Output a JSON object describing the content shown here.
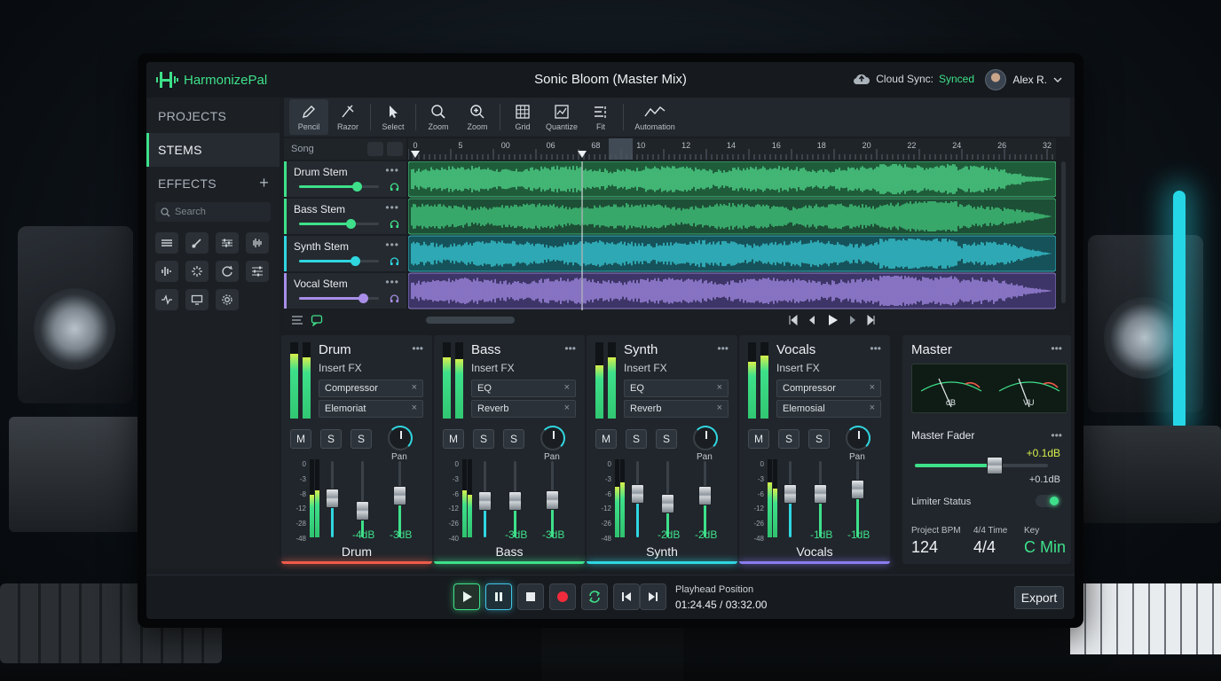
{
  "app": {
    "name": "HarmonizePal",
    "project_title": "Sonic Bloom (Master Mix)",
    "cloud_sync_label": "Cloud Sync:",
    "cloud_sync_status": "Synced",
    "user_name": "Alex R."
  },
  "sidebar": {
    "items": [
      {
        "label": "PROJECTS"
      },
      {
        "label": "STEMS"
      },
      {
        "label": "EFFECTS"
      }
    ],
    "search_placeholder": "Search",
    "add_label": "+",
    "fx_icons": [
      "stack-icon",
      "guitar-icon",
      "eq-sliders-icon",
      "waveform-icon",
      "bars-icon",
      "sparkle-icon",
      "loop-icon",
      "mixer-icon",
      "pulse-icon",
      "monitor-icon",
      "gear-icon"
    ]
  },
  "toolbar": {
    "tools": [
      {
        "label": "Pencil",
        "icon": "pencil-icon"
      },
      {
        "label": "Razor",
        "icon": "razor-icon"
      },
      {
        "label": "Select",
        "icon": "cursor-icon"
      },
      {
        "label": "Zoom",
        "icon": "zoom-out-icon"
      },
      {
        "label": "Zoom",
        "icon": "zoom-in-icon"
      },
      {
        "label": "Grid",
        "icon": "grid-icon"
      },
      {
        "label": "Quantize",
        "icon": "quantize-icon"
      },
      {
        "label": "Fit",
        "icon": "fit-icon"
      },
      {
        "label": "Automation",
        "icon": "automation-icon"
      }
    ]
  },
  "timeline": {
    "song_label": "Song",
    "ruler_ticks": [
      "0",
      "5",
      "00",
      "06",
      "68",
      "10",
      "12",
      "14",
      "16",
      "18",
      "20",
      "22",
      "24",
      "26",
      "32"
    ]
  },
  "tracks": [
    {
      "name": "Drum Stem",
      "color": "#3ee08a",
      "volume": 0.72
    },
    {
      "name": "Bass Stem",
      "color": "#3ee08a",
      "volume": 0.65
    },
    {
      "name": "Synth Stem",
      "color": "#2fd6e0",
      "volume": 0.7
    },
    {
      "name": "Vocal Stem",
      "color": "#a88ee8",
      "volume": 0.8
    }
  ],
  "mixer": {
    "insert_label": "Insert FX",
    "pan_label": "Pan",
    "scale": [
      "0",
      "-3",
      "-8",
      "-12",
      "-28",
      "-48"
    ],
    "strips": [
      {
        "name": "Drum",
        "fx": [
          "Compressor",
          "Elemoriat"
        ],
        "db_a": "-4dB",
        "db_b": "-3dB",
        "color": "#ef5a4a",
        "footer": "Drum",
        "vu": [
          0.85,
          0.8
        ],
        "mvu": [
          0.55,
          0.6
        ],
        "fader_a": 0.62,
        "fader_b": 0.38,
        "fader_c": 0.66,
        "scale": [
          "0",
          "-3",
          "-8",
          "-12",
          "-28",
          "-48"
        ]
      },
      {
        "name": "Bass",
        "fx": [
          "EQ",
          "Reverb"
        ],
        "db_a": "-3dB",
        "db_b": "-3dB",
        "color": "#3ee08a",
        "footer": "Bass",
        "vu": [
          0.8,
          0.78
        ],
        "mvu": [
          0.6,
          0.55
        ],
        "fader_a": 0.56,
        "fader_b": 0.56,
        "fader_c": 0.58,
        "scale": [
          "0",
          "-3",
          "-6",
          "-12",
          "-26",
          "-40"
        ]
      },
      {
        "name": "Synth",
        "fx": [
          "EQ",
          "Reverb"
        ],
        "db_a": "-2dB",
        "db_b": "-2dB",
        "color": "#2fd6e0",
        "footer": "Synth",
        "vu": [
          0.7,
          0.8
        ],
        "mvu": [
          0.65,
          0.7
        ],
        "fader_a": 0.7,
        "fader_b": 0.52,
        "fader_c": 0.66,
        "scale": [
          "0",
          "-3",
          "-6",
          "-12",
          "-26",
          "-48"
        ]
      },
      {
        "name": "Vocals",
        "fx": [
          "Compressor",
          "Elemosial"
        ],
        "db_a": "-1dB",
        "db_b": "-1dB",
        "color": "#8a7bf0",
        "footer": "Vocals",
        "vu": [
          0.75,
          0.82
        ],
        "mvu": [
          0.7,
          0.62
        ],
        "fader_a": 0.7,
        "fader_b": 0.7,
        "fader_c": 0.78,
        "scale": [
          "0",
          "-3",
          "-6",
          "-12",
          "-26",
          "-48"
        ]
      }
    ]
  },
  "master": {
    "name": "Master",
    "vu_left": "dB",
    "vu_right": "VU",
    "fader_label": "Master Fader",
    "fader_value": "+0.1dB",
    "fader_value_sub": "+0.1dB",
    "fader_level": 0.58,
    "limiter_label": "Limiter Status",
    "limiter_on": true,
    "stats": [
      {
        "label": "Project BPM",
        "value": "124",
        "color": "#eef1f4"
      },
      {
        "label": "4/4 Time",
        "value": "4/4",
        "color": "#eef1f4"
      },
      {
        "label": "Key",
        "value": "C Min",
        "color": "#3ee08a"
      }
    ]
  },
  "transport": {
    "playhead_label": "Playhead Position",
    "playhead_time": "01:24.45 / 03:32.00",
    "export_label": "Export"
  }
}
